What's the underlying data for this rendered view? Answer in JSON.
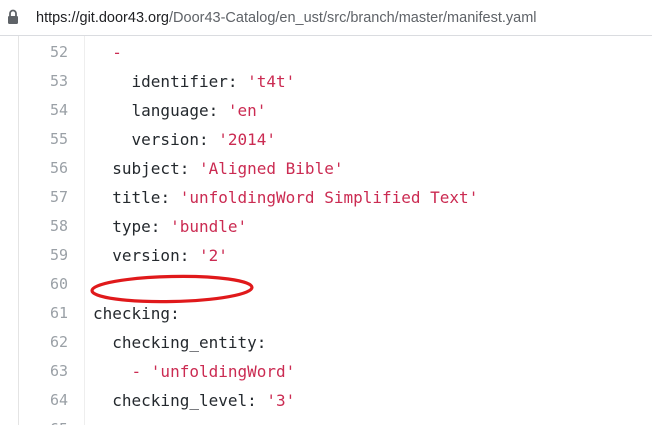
{
  "browser": {
    "url_host": "https://git.door43.org",
    "url_path": "/Door43-Catalog/en_ust/src/branch/master/manifest.yaml"
  },
  "code": {
    "lines": [
      {
        "num": "52",
        "indent": "  ",
        "key": "",
        "sep": "",
        "value": "",
        "dash": "-"
      },
      {
        "num": "53",
        "indent": "    ",
        "key": "identifier",
        "sep": ": ",
        "value": "'t4t'",
        "dash": ""
      },
      {
        "num": "54",
        "indent": "    ",
        "key": "language",
        "sep": ": ",
        "value": "'en'",
        "dash": ""
      },
      {
        "num": "55",
        "indent": "    ",
        "key": "version",
        "sep": ": ",
        "value": "'2014'",
        "dash": ""
      },
      {
        "num": "56",
        "indent": "  ",
        "key": "subject",
        "sep": ": ",
        "value": "'Aligned Bible'",
        "dash": ""
      },
      {
        "num": "57",
        "indent": "  ",
        "key": "title",
        "sep": ": ",
        "value": "'unfoldingWord Simplified Text'",
        "dash": ""
      },
      {
        "num": "58",
        "indent": "  ",
        "key": "type",
        "sep": ": ",
        "value": "'bundle'",
        "dash": ""
      },
      {
        "num": "59",
        "indent": "  ",
        "key": "version",
        "sep": ": ",
        "value": "'2'",
        "dash": ""
      },
      {
        "num": "60",
        "indent": "",
        "key": "",
        "sep": "",
        "value": "",
        "dash": ""
      },
      {
        "num": "61",
        "indent": "",
        "key": "checking",
        "sep": ":",
        "value": "",
        "dash": ""
      },
      {
        "num": "62",
        "indent": "  ",
        "key": "checking_entity",
        "sep": ":",
        "value": "",
        "dash": ""
      },
      {
        "num": "63",
        "indent": "    ",
        "key": "",
        "sep": "",
        "value": "'unfoldingWord'",
        "dash": "- "
      },
      {
        "num": "64",
        "indent": "  ",
        "key": "checking_level",
        "sep": ": ",
        "value": "'3'",
        "dash": ""
      },
      {
        "num": "65",
        "indent": "",
        "key": "",
        "sep": "",
        "value": "",
        "dash": ""
      }
    ]
  },
  "annotation": {
    "color": "#e0191b"
  }
}
